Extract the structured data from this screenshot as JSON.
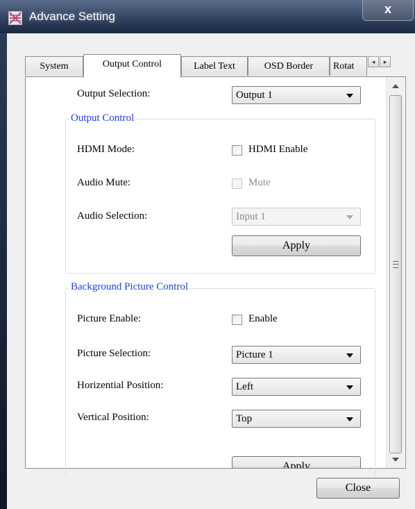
{
  "window": {
    "title": "Advance Setting",
    "close_glyph": "x"
  },
  "tabs": [
    {
      "label": "System",
      "active": false
    },
    {
      "label": "Output Control",
      "active": true
    },
    {
      "label": "Label Text",
      "active": false
    },
    {
      "label": "OSD Border",
      "active": false
    },
    {
      "label": "Rotat",
      "active": false
    }
  ],
  "tab_scroll": {
    "left": "◂",
    "right": "▸"
  },
  "output_selection": {
    "label": "Output Selection:",
    "value": "Output 1"
  },
  "output_control": {
    "title": "Output Control",
    "hdmi_mode": {
      "label": "HDMI Mode:",
      "checkbox_label": "HDMI Enable",
      "checked": false
    },
    "audio_mute": {
      "label": "Audio Mute:",
      "checkbox_label": "Mute",
      "checked": false,
      "enabled": false
    },
    "audio_selection": {
      "label": "Audio Selection:",
      "value": "Input 1",
      "enabled": false
    },
    "apply_label": "Apply"
  },
  "background_picture_control": {
    "title": "Background Picture Control",
    "picture_enable": {
      "label": "Picture Enable:",
      "checkbox_label": "Enable",
      "checked": false
    },
    "picture_selection": {
      "label": "Picture Selection:",
      "value": "Picture 1"
    },
    "horizontal_position": {
      "label": "Horizential Position:",
      "value": "Left"
    },
    "vertical_position": {
      "label": "Vertical Position:",
      "value": "Top"
    },
    "apply_label": "Apply"
  },
  "close_button_label": "Close"
}
